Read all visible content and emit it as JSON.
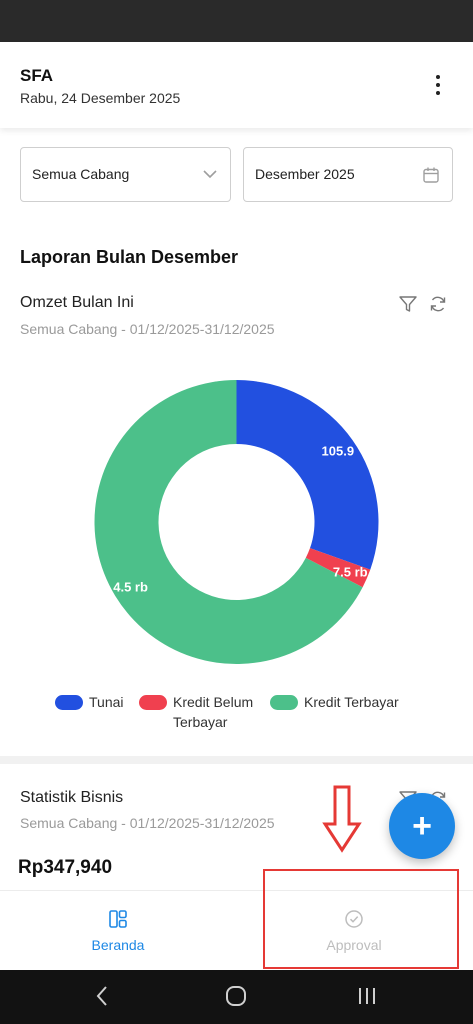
{
  "header": {
    "title": "SFA",
    "date": "Rabu, 24 Desember 2025"
  },
  "filters": {
    "branch": "Semua Cabang",
    "month": "Desember 2025"
  },
  "report_section": {
    "title": "Laporan Bulan Desember"
  },
  "omzet_card": {
    "title": "Omzet Bulan Ini",
    "subtitle": "Semua Cabang - 01/12/2025-31/12/2025"
  },
  "chart_data": {
    "type": "pie",
    "categories": [
      "Tunai",
      "Kredit Belum Terbayar",
      "Kredit Terbayar"
    ],
    "values": [
      105.9,
      7.5,
      234.5
    ],
    "data_labels": [
      "105.9",
      "7.5 rb",
      "4.5 rb"
    ],
    "colors": [
      "#2250e0",
      "#f0404f",
      "#4cc08a"
    ],
    "legend_position": "bottom"
  },
  "legend": {
    "item1": "Tunai",
    "item2_line1": "Kredit Belum",
    "item2_line2": "Terbayar",
    "item3": "Kredit Terbayar"
  },
  "stats_card": {
    "title": "Statistik Bisnis",
    "subtitle": "Semua Cabang - 01/12/2025-31/12/2025",
    "value": "Rp347,940"
  },
  "fab": {
    "label": "+"
  },
  "bottom_nav": {
    "home": "Beranda",
    "approval": "Approval"
  },
  "colors": {
    "accent": "#1e88e5",
    "annotation": "#e53935"
  }
}
